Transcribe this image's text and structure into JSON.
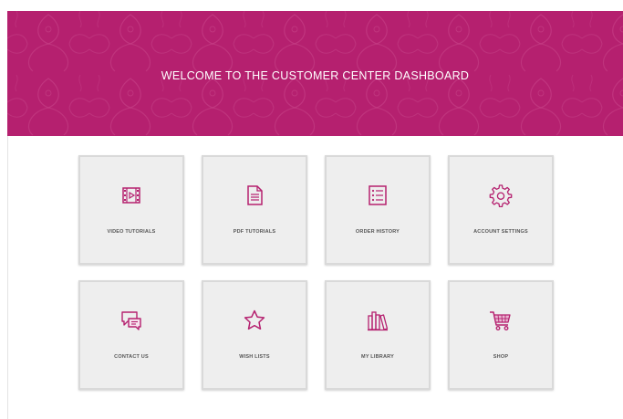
{
  "header": {
    "title": "WELCOME TO THE CUSTOMER CENTER DASHBOARD",
    "background_color": "#b5206f"
  },
  "tiles": [
    {
      "label": "VIDEO TUTORIALS",
      "icon": "video-film-icon"
    },
    {
      "label": "PDF TUTORIALS",
      "icon": "document-icon"
    },
    {
      "label": "ORDER HISTORY",
      "icon": "list-icon"
    },
    {
      "label": "ACCOUNT SETTINGS",
      "icon": "gear-icon"
    },
    {
      "label": "CONTACT US",
      "icon": "chat-bubbles-icon"
    },
    {
      "label": "WISH LISTS",
      "icon": "star-icon"
    },
    {
      "label": "MY LIBRARY",
      "icon": "books-icon"
    },
    {
      "label": "SHOP",
      "icon": "shopping-cart-icon"
    }
  ],
  "colors": {
    "accent": "#b5206f",
    "tile_background": "#eeeeee",
    "tile_border": "#d9d9d9",
    "label_text": "#555555"
  }
}
